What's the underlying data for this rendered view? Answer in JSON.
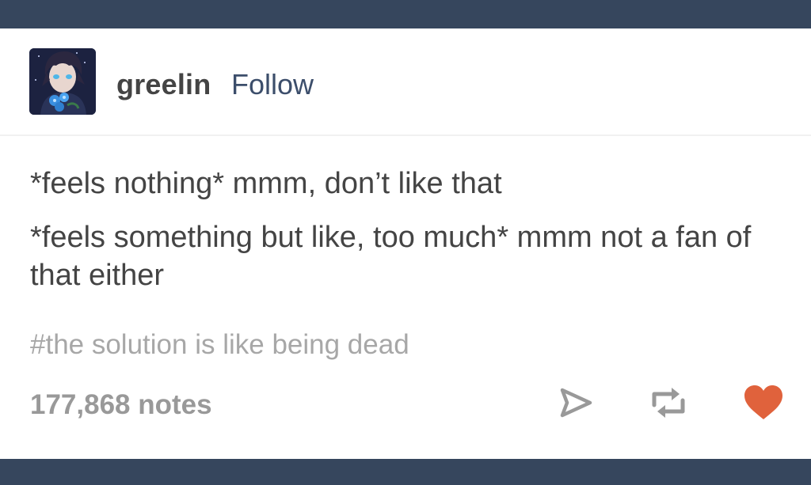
{
  "post": {
    "author": "greelin",
    "follow_label": "Follow",
    "paragraphs": [
      "*feels nothing* mmm, don’t like that",
      "*feels something but like, too much* mmm not a fan of that either"
    ],
    "tags": "#the solution is like being dead",
    "notes": "177,868 notes"
  },
  "actions": [
    {
      "icon": "share-icon"
    },
    {
      "icon": "reblog-icon"
    },
    {
      "icon": "like-heart-icon"
    }
  ],
  "colors": {
    "bar": "#36465d",
    "follow": "#3c4e6b",
    "text": "#444444",
    "tag": "#a7a7a7",
    "icon": "#999999",
    "heart": "#e0623c"
  }
}
